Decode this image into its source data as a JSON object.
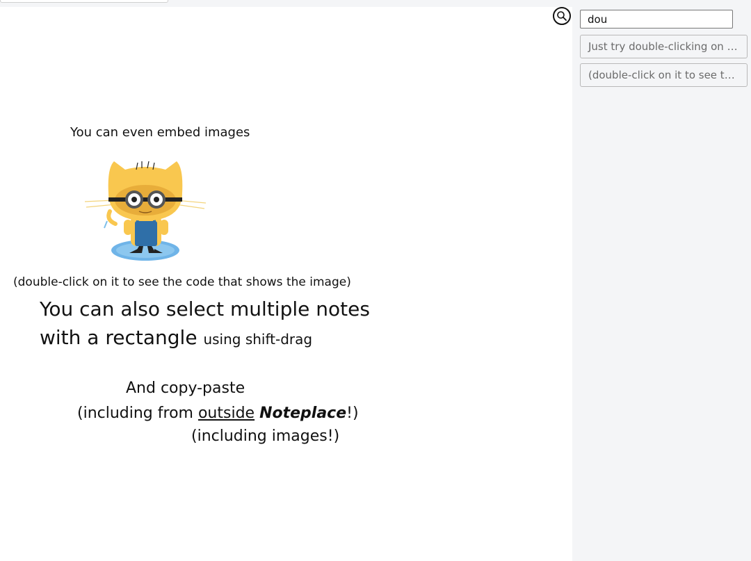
{
  "search": {
    "value": "dou",
    "icon": "search-icon"
  },
  "results": [
    {
      "label": "Just try double-clicking on e···"
    },
    {
      "label": "(double-click on it to see the ···"
    }
  ],
  "canvas": {
    "embed_note": "You can even embed images",
    "image": "octocat-minion-illustration",
    "dblclick_note": "(double-click on it to see the code that shows the image)",
    "select_note": {
      "line1": "You can also select multiple notes",
      "line2": "with a rectangle",
      "small": "using shift-drag"
    },
    "copy_note": {
      "line1": "And copy-paste",
      "line2_prefix": "(including from ",
      "line2_link": "outside",
      "line2_space": " ",
      "line2_bold": "Noteplace",
      "line2_suffix": "!)",
      "line3": "(including images!)"
    }
  },
  "colors": {
    "sidebar_bg": "#f4f5f7",
    "result_text": "#6b6b6b",
    "octocat_fur": "#f9c74f",
    "overalls": "#2f6fa8"
  }
}
